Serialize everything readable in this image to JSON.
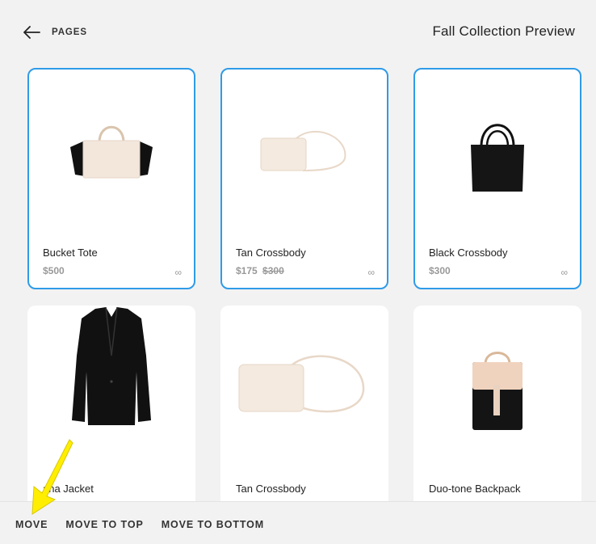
{
  "header": {
    "back_label": "PAGES",
    "title": "Fall Collection Preview"
  },
  "products": [
    {
      "name": "Bucket Tote",
      "price": "$500",
      "old_price": "",
      "link_icon": "∞",
      "selected": true,
      "image": "bucket-tote-image"
    },
    {
      "name": "Tan Crossbody",
      "price": "$175",
      "old_price": "$300",
      "link_icon": "∞",
      "selected": true,
      "image": "tan-crossbody-image"
    },
    {
      "name": "Black Crossbody",
      "price": "$300",
      "old_price": "",
      "link_icon": "∞",
      "selected": true,
      "image": "black-crossbody-image"
    },
    {
      "name": "ana Jacket",
      "price": "",
      "old_price": "",
      "link_icon": "",
      "selected": false,
      "image": "jacket-image"
    },
    {
      "name": "Tan Crossbody",
      "price": "",
      "old_price": "",
      "link_icon": "",
      "selected": false,
      "image": "tan-crossbody-large-image"
    },
    {
      "name": "Duo-tone Backpack",
      "price": "",
      "old_price": "",
      "link_icon": "",
      "selected": false,
      "image": "backpack-image"
    }
  ],
  "toolbar": {
    "move_label": "MOVE",
    "move_top_label": "MOVE TO TOP",
    "move_bottom_label": "MOVE TO BOTTOM"
  },
  "colors": {
    "selection_border": "#2f9be8",
    "cursor_highlight": "#ffee00",
    "background": "#f2f2f2"
  },
  "icons": {
    "back": "arrow-left-icon",
    "product_link": "link-icon",
    "pointer": "yellow-arrow-pointer"
  }
}
